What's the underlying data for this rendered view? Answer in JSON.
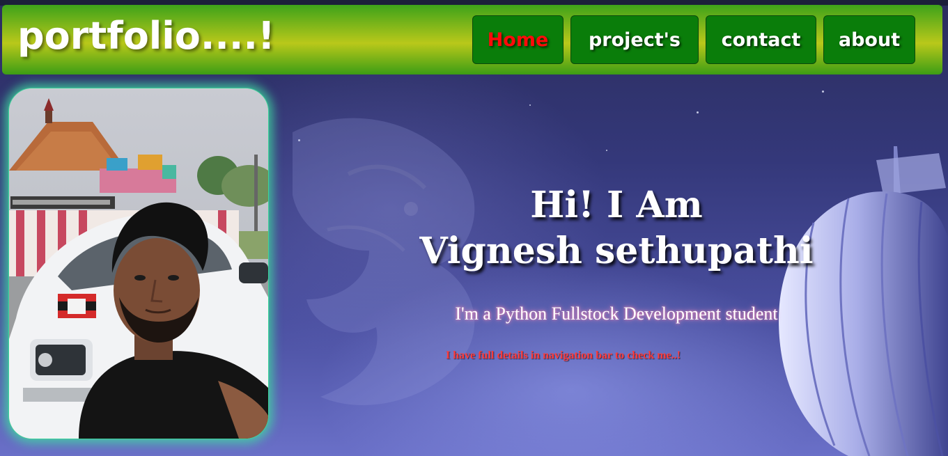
{
  "header": {
    "logo": "portfolio....!",
    "nav": [
      {
        "label": "Home",
        "active": true
      },
      {
        "label": "project's",
        "active": false
      },
      {
        "label": "contact",
        "active": false
      },
      {
        "label": "about",
        "active": false
      }
    ]
  },
  "hero": {
    "greeting": "Hi! I Am",
    "name": "Vignesh sethupathi",
    "tagline": "I'm a Python Fullstock Development student",
    "note": "I have full details in navigation bar to check me..!"
  },
  "colors": {
    "header_green": "#3ea21a",
    "header_yellow": "#b9c81a",
    "nav_button": "#0a7d0a",
    "active_nav_text": "#ff0a0a",
    "note_text": "#ff3b3b",
    "photo_glow": "#40dca0"
  },
  "images": {
    "profile_photo": "profile-photo",
    "background": "night-sky-dragon-balloon"
  }
}
